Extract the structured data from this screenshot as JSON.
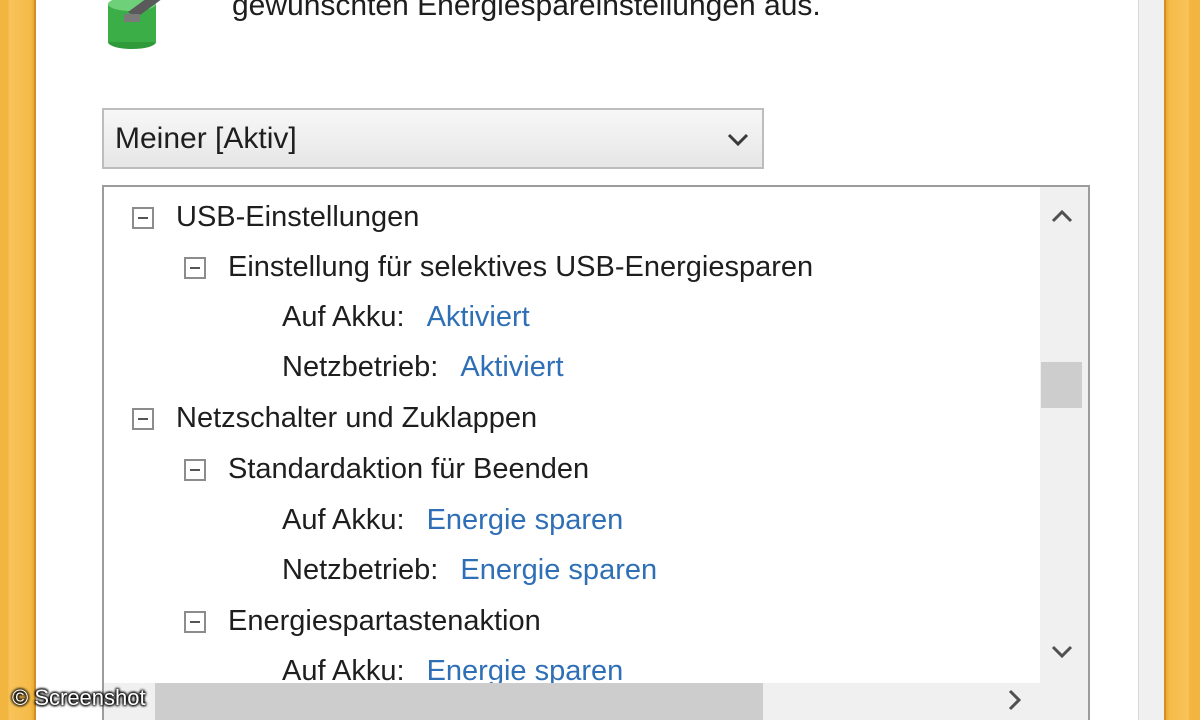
{
  "header": {
    "text": "gewünschten Energiespareinstellungen aus.",
    "icon": "power-plan-battery-icon"
  },
  "plan_select": {
    "value": "Meiner [Aktiv]",
    "icon": "chevron-down-icon"
  },
  "tree": {
    "usb_section": {
      "label": "USB-Einstellungen",
      "child": {
        "label": "Einstellung für selektives USB-Energiesparen",
        "battery_label": "Auf Akku:",
        "battery_value": "Aktiviert",
        "ac_label": "Netzbetrieb:",
        "ac_value": "Aktiviert"
      }
    },
    "power_section": {
      "label": "Netzschalter und Zuklappen",
      "shutdown": {
        "label": "Standardaktion für Beenden",
        "battery_label": "Auf Akku:",
        "battery_value": "Energie sparen",
        "ac_label": "Netzbetrieb:",
        "ac_value": "Energie sparen"
      },
      "sleep_button": {
        "label": "Energiespartastenaktion",
        "battery_label": "Auf Akku:",
        "battery_value": "Energie sparen"
      }
    }
  },
  "watermark": "© Screenshot",
  "colors": {
    "frame": "#f2b640",
    "link_value": "#2f6fb6",
    "scrollbar_thumb": "#cdcdcd"
  }
}
